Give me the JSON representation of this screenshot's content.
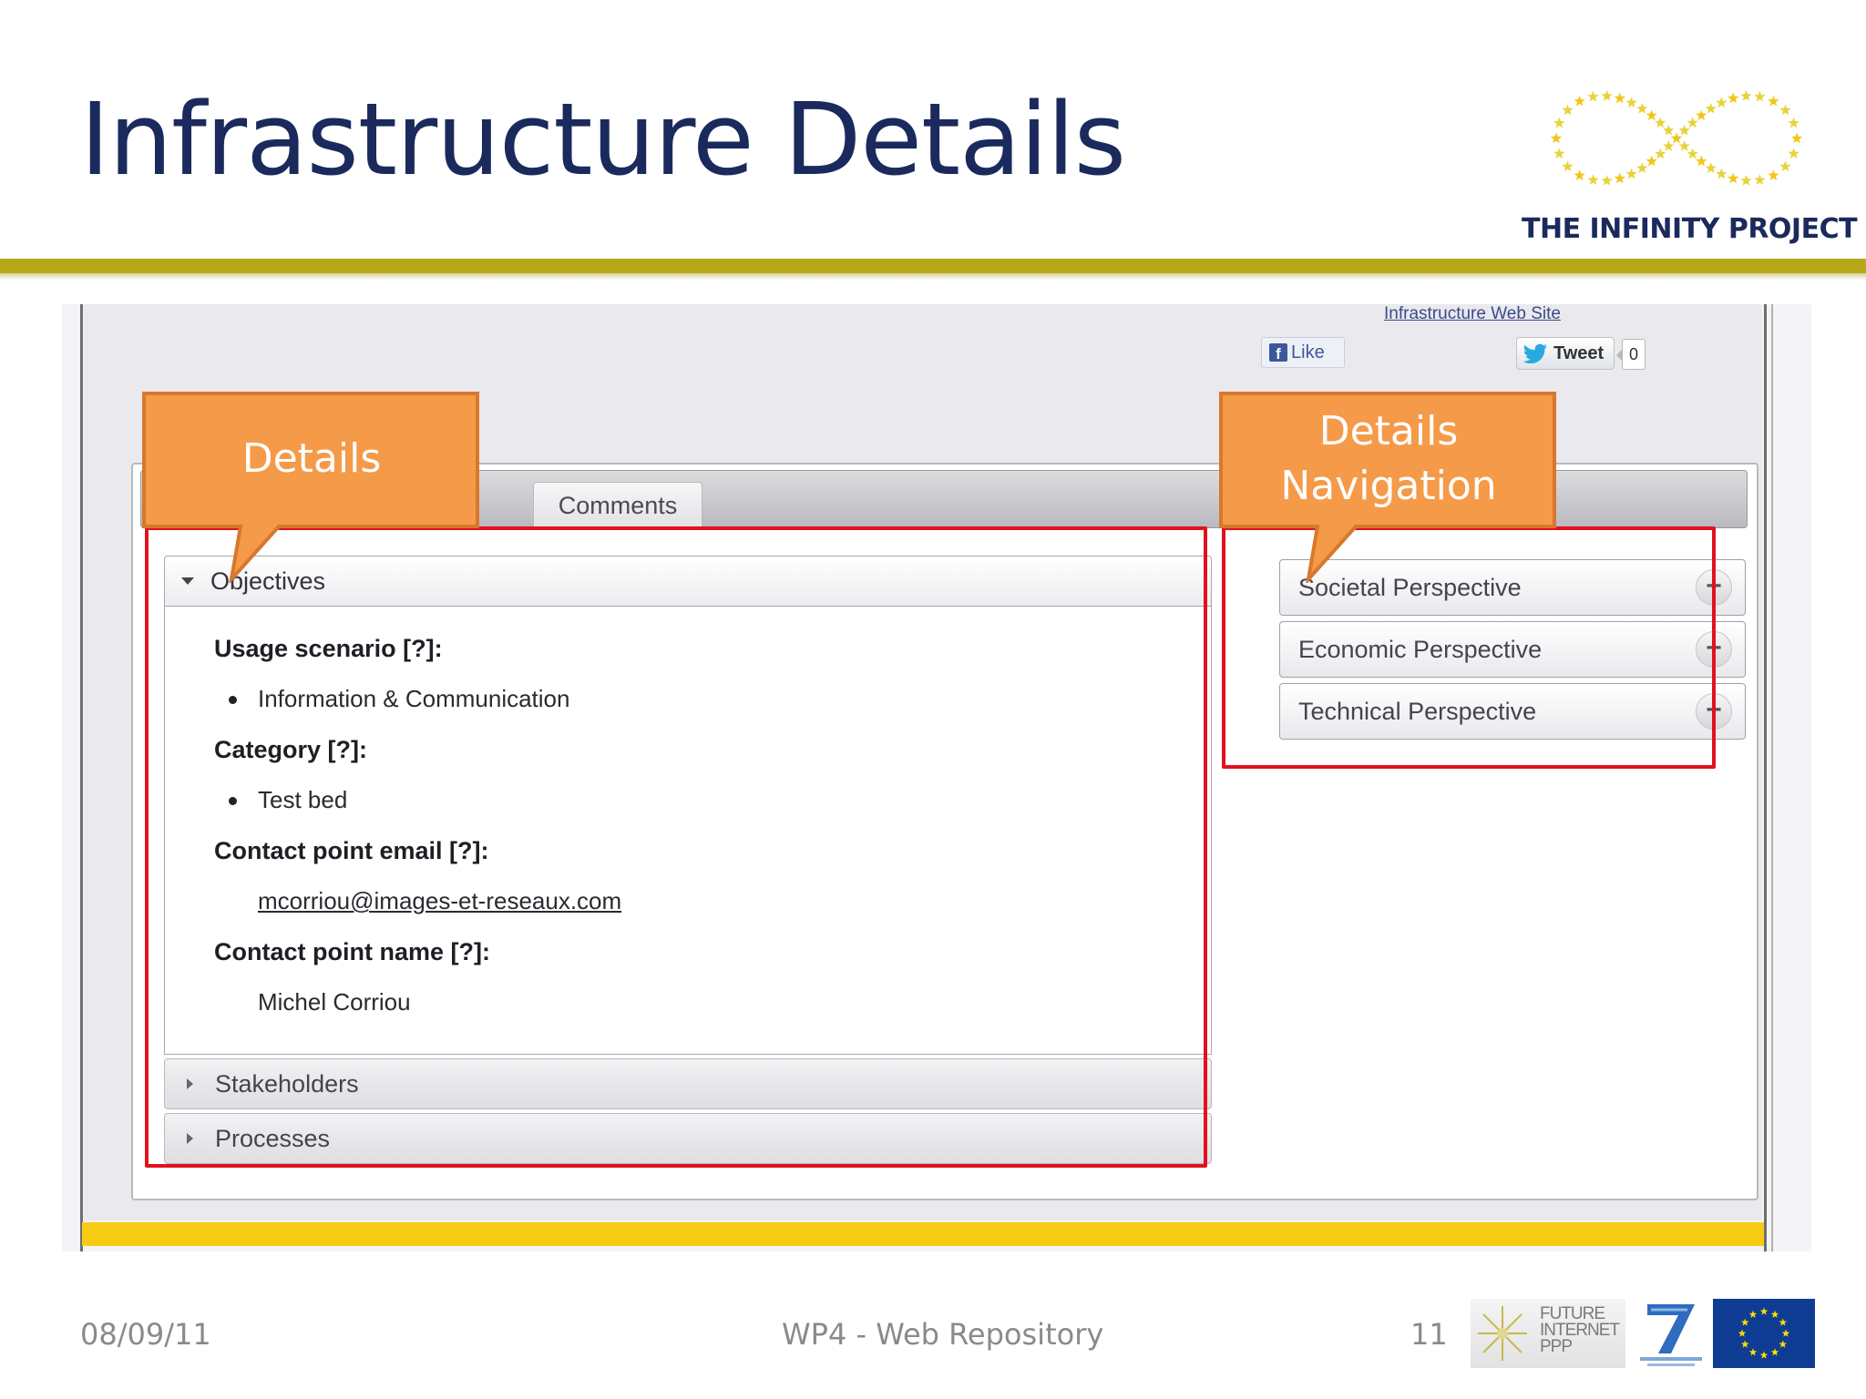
{
  "slide": {
    "title": "Infrastructure Details",
    "logo_caption": "THE INFINITY PROJECT"
  },
  "screenshot": {
    "site_link": "Infrastructure Web Site",
    "like_label": "Like",
    "tweet_label": "Tweet",
    "tweet_count": "0",
    "tabs": [
      {
        "label": ""
      },
      {
        "label": "Comments"
      }
    ],
    "accordion": {
      "open_section": "Objectives",
      "fields": [
        {
          "label": "Usage scenario [?]:",
          "value": "Information & Communication"
        },
        {
          "label": "Category [?]:",
          "value": "Test bed"
        },
        {
          "label": "Contact point email [?]:",
          "value": "mcorriou@images-et-reseaux.com"
        },
        {
          "label": "Contact point name [?]:",
          "value": "Michel Corriou"
        }
      ],
      "collapsed_sections": [
        "Stakeholders",
        "Processes"
      ]
    },
    "navigation": [
      {
        "label": "Societal Perspective"
      },
      {
        "label": "Economic Perspective"
      },
      {
        "label": "Technical Perspective"
      }
    ],
    "plus_glyph": "+"
  },
  "callouts": {
    "details": "Details",
    "navigation_line1": "Details",
    "navigation_line2": "Navigation"
  },
  "footer": {
    "date": "08/09/11",
    "center": "WP4 - Web Repository",
    "page": "11",
    "fi_logo": [
      "FUTURE",
      "INTERNET",
      "PPP"
    ]
  },
  "colors": {
    "title": "#1b2a5c",
    "header_rule": "#b7a81b",
    "callout": "#f59a48",
    "callout_border": "#d9772c",
    "highlight_box": "#e0121e",
    "strip": "#f6cc12"
  },
  "icons": [
    "infinity-stars-logo",
    "facebook-icon",
    "twitter-bird-icon",
    "expand-triangle-icon",
    "collapsed-triangle-icon",
    "plus-icon",
    "future-internet-logo",
    "fp7-logo",
    "eu-flag"
  ]
}
